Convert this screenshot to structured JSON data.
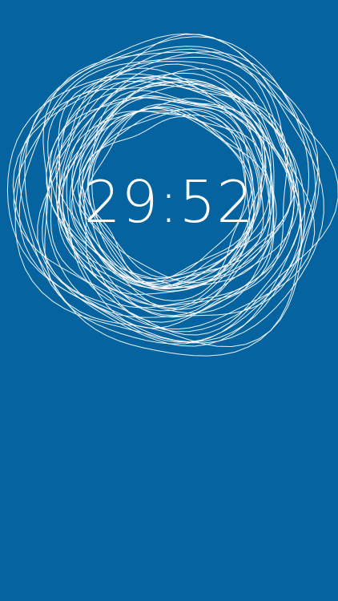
{
  "timer": {
    "display": "29:52"
  },
  "colors": {
    "background": "#05649f",
    "foreground": "#ffffff"
  },
  "graphic": {
    "icon": "scribble-circle"
  }
}
